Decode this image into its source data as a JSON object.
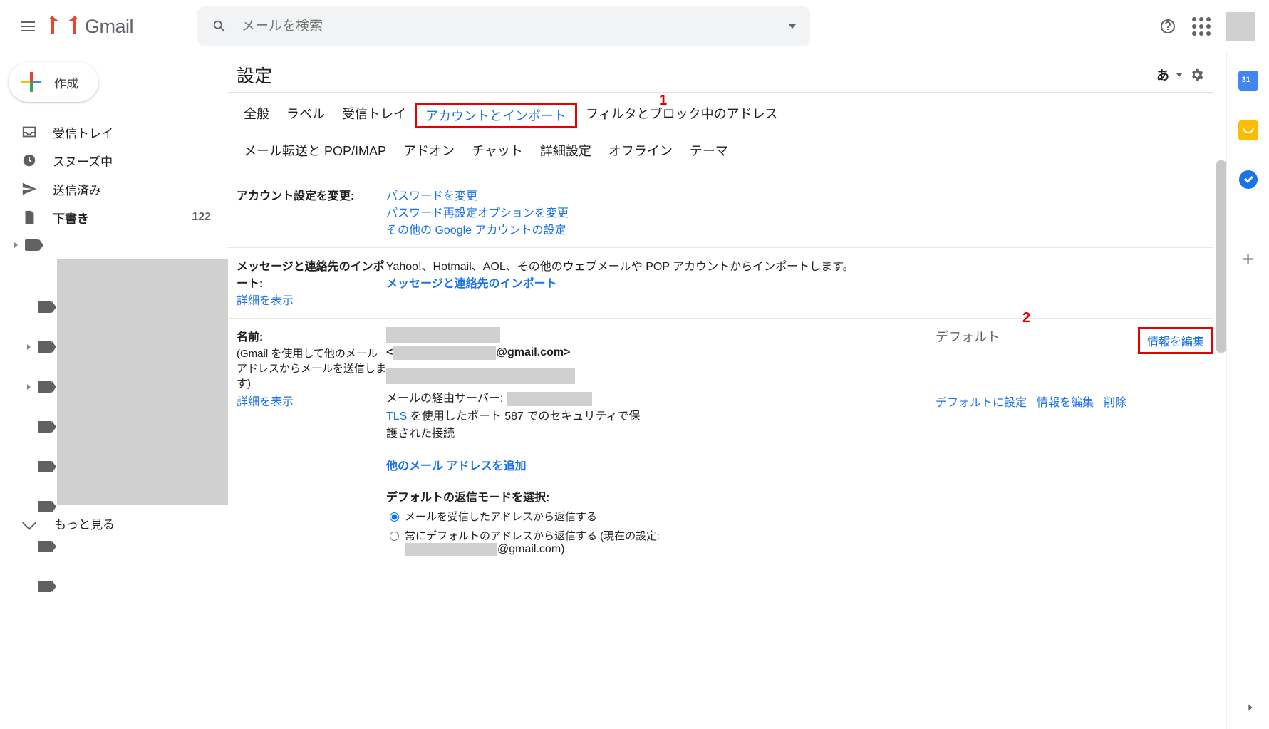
{
  "header": {
    "product": "Gmail",
    "search_placeholder": "メールを検索",
    "lang_indicator": "あ"
  },
  "compose": {
    "label": "作成"
  },
  "sidebar": {
    "items": [
      {
        "label": "受信トレイ",
        "icon": "inbox"
      },
      {
        "label": "スヌーズ中",
        "icon": "clock"
      },
      {
        "label": "送信済み",
        "icon": "sent"
      },
      {
        "label": "下書き",
        "icon": "file",
        "count": "122",
        "bold": true
      }
    ],
    "more": "もっと見る"
  },
  "page": {
    "title": "設定"
  },
  "tabs": {
    "row1": [
      "全般",
      "ラベル",
      "受信トレイ",
      "アカウントとインポート",
      "フィルタとブロック中のアドレス"
    ],
    "row2": [
      "メール転送と POP/IMAP",
      "アドオン",
      "チャット",
      "詳細設定",
      "オフライン",
      "テーマ"
    ],
    "active_index": 3
  },
  "callouts": {
    "c1": "1",
    "c2": "2"
  },
  "sections": {
    "change": {
      "title": "アカウント設定を変更:",
      "links": [
        "パスワードを変更",
        "パスワード再設定オプションを変更",
        "その他の Google アカウントの設定"
      ]
    },
    "import": {
      "title": "メッセージと連絡先のインポート:",
      "desc": "Yahoo!、Hotmail、AOL、その他のウェブメールや POP アカウントからインポートします。",
      "link": "メッセージと連絡先のインポート",
      "detail": "詳細を表示"
    },
    "name": {
      "title": "名前:",
      "sub": "(Gmail を使用して他のメール アドレスからメールを送信します)",
      "detail": "詳細を表示",
      "email_suffix": "@gmail.com>",
      "email_prefix": "<",
      "via_label": "メールの経由サーバー:",
      "tls_prefix": "TLS",
      "tls_rest": " を使用したポート 587 でのセキュリティで保護された接続",
      "add_other": "他のメール アドレスを追加",
      "default": "デフォルト",
      "edit": "情報を編集",
      "set_default": "デフォルトに設定",
      "delete": "削除",
      "reply_title": "デフォルトの返信モードを選択:",
      "reply_opt1": "メールを受信したアドレスから返信する",
      "reply_opt2_a": "常にデフォルトのアドレスから返信する (現在の設定:",
      "reply_opt2_b": "@gmail.com)"
    }
  }
}
